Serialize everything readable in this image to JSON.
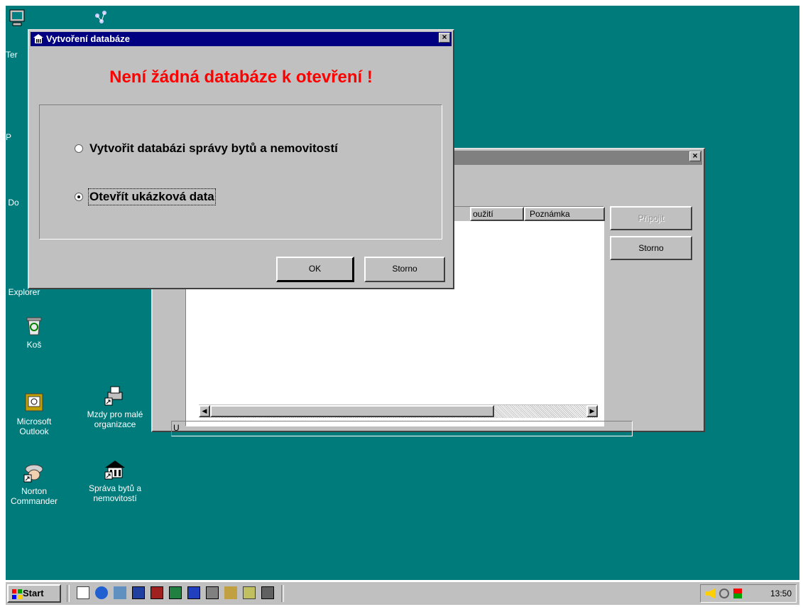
{
  "desktop": {
    "icons": [
      {
        "label": "Ter"
      },
      {
        "label": "P"
      },
      {
        "label": "Do"
      },
      {
        "label": "Explorer"
      },
      {
        "label": "Koš"
      },
      {
        "label": "Microsoft Outlook"
      },
      {
        "label": "Mzdy pro malé organizace"
      },
      {
        "label": "Norton Commander"
      },
      {
        "label": "Správa bytů a nemovitostí"
      }
    ]
  },
  "back_window": {
    "columns": [
      "oužití",
      "Poznámka"
    ],
    "connect_label": "Připojit",
    "cancel_label": "Storno",
    "status_label": "U",
    "close_label": "×"
  },
  "dialog": {
    "title": "Vytvoření databáze",
    "heading": "Není žádná databáze k otevření !",
    "heading_color": "#ff0000",
    "options": [
      {
        "label": "Vytvořit databázi správy bytů a nemovitostí",
        "selected": false
      },
      {
        "label": "Otevřít ukázková data",
        "selected": true
      }
    ],
    "ok_label": "OK",
    "cancel_label": "Storno",
    "close_label": "×"
  },
  "taskbar": {
    "start_label": "Start",
    "clock": "13:50"
  }
}
